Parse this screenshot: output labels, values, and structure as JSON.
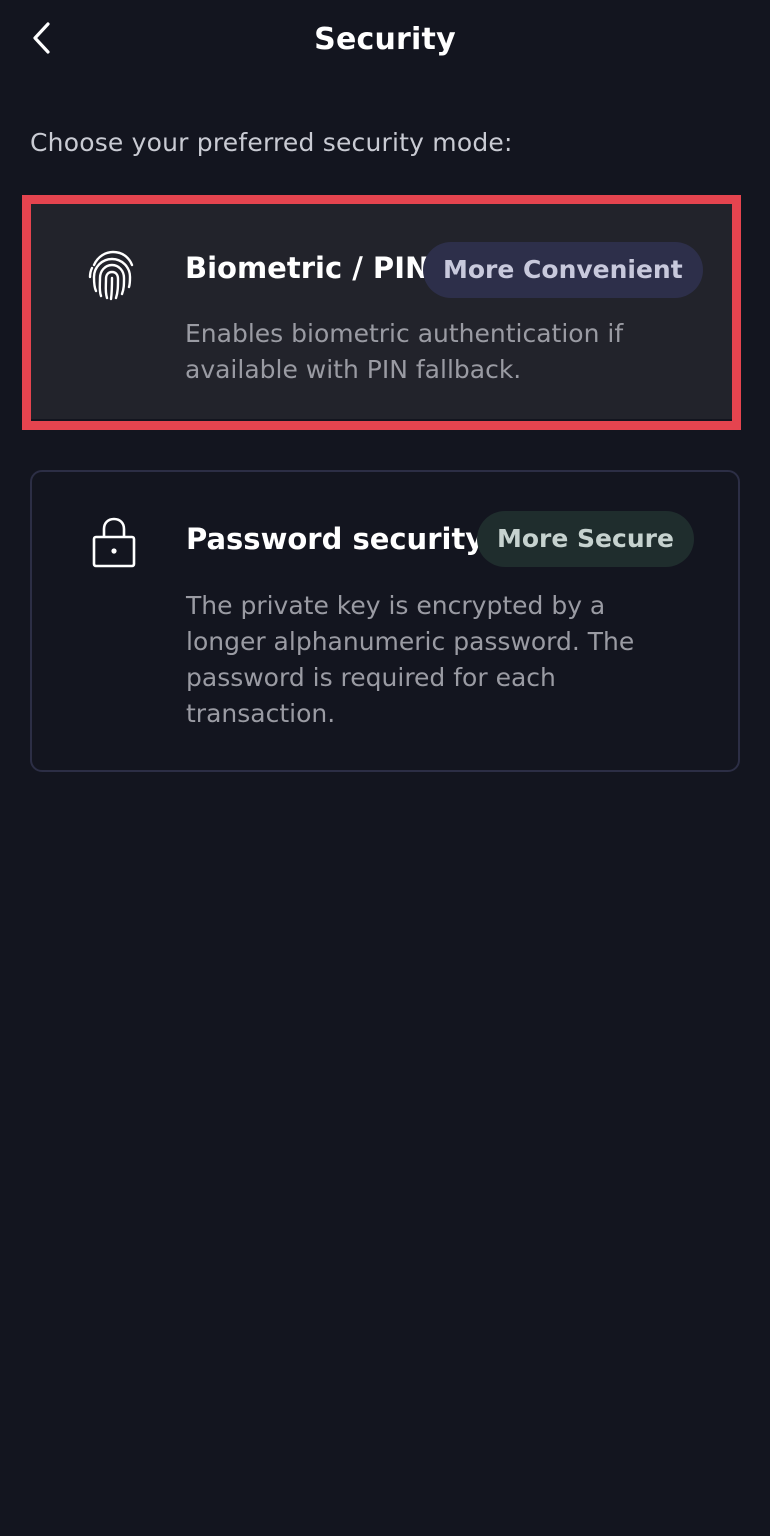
{
  "header": {
    "title": "Security",
    "back_icon": "chevron-left-icon"
  },
  "prompt": "Choose your preferred security mode:",
  "options": [
    {
      "icon": "fingerprint-icon",
      "title": "Biometric / PIN",
      "badge": "More Convenient",
      "description": "Enables biometric authentication if available with PIN fallback.",
      "selected": true
    },
    {
      "icon": "lock-icon",
      "title": "Password security",
      "badge": "More Secure",
      "description": "The private key is encrypted by a longer alphanumeric password. The password is required for each transaction.",
      "selected": false
    }
  ],
  "colors": {
    "background": "#13151f",
    "selected_card": "#22232b",
    "highlight": "#e5444f",
    "card_border": "#2c2e45",
    "badge_convenient": "#2d2f4a",
    "badge_secure": "#1f2d2d"
  }
}
